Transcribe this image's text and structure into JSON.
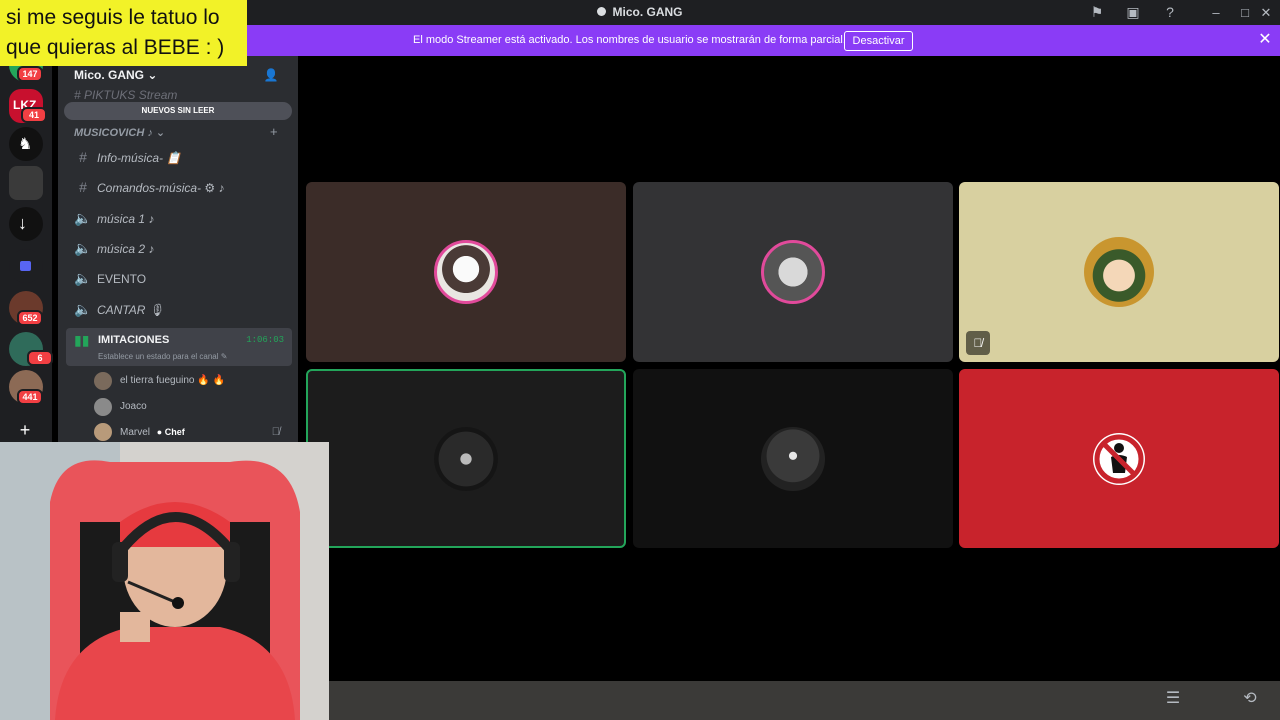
{
  "window": {
    "title": "Mico. GANG",
    "icons": [
      "flag-icon",
      "inbox-icon",
      "help-icon"
    ],
    "controls": [
      "minimize",
      "maximize",
      "close"
    ]
  },
  "banner": {
    "message": "El modo Streamer está activado. Los nombres de usuario se mostrarán de forma parcial.",
    "button": "Desactivar",
    "close": "✕"
  },
  "caption": {
    "line1": "si me seguis le tatuo lo",
    "line2": "que quieras al BEBE : )"
  },
  "servers": [
    {
      "badge": "147"
    },
    {
      "label": "LKZ",
      "badge": "41"
    },
    {
      "badge": ""
    },
    {
      "badge": ""
    },
    {
      "badge": ""
    },
    {
      "badge": ""
    },
    {
      "badge": "652"
    },
    {
      "badge": "6"
    },
    {
      "badge": "441"
    }
  ],
  "sidebar": {
    "server_name": "Mico. GANG",
    "faded_channel": "PIKTUKS Stream",
    "unread_pill": "NUEVOS SIN LEER",
    "category": "MUSICOVICH",
    "channels": [
      {
        "name": "Info-música-",
        "type": "text"
      },
      {
        "name": "Comandos-música-",
        "type": "text"
      },
      {
        "name": "música 1",
        "type": "voice"
      },
      {
        "name": "música 2",
        "type": "voice"
      },
      {
        "name": "EVENTO",
        "type": "voice"
      },
      {
        "name": "CANTAR",
        "type": "voice"
      }
    ],
    "active_channel": {
      "name": "IMITACIONES",
      "timer": "1:06:03",
      "status": "Establece un estado para el canal"
    },
    "voice_users": [
      {
        "name": "el tierra fueguino",
        "tag": "",
        "muted": false
      },
      {
        "name": "Joaco",
        "tag": "",
        "muted": false
      },
      {
        "name": "Marvel",
        "tag": "Chef",
        "muted": true
      }
    ]
  },
  "tiles": [
    {
      "bg": "#3b2c28",
      "avatar": "cat-avatar",
      "speaking": false,
      "muted": false
    },
    {
      "bg": "#333335",
      "avatar": "man-avatar",
      "speaking": false,
      "muted": false
    },
    {
      "bg": "#d8d0a0",
      "avatar": "mii-avatar",
      "speaking": false,
      "muted": true
    },
    {
      "bg": "#1c1c1c",
      "avatar": "dark-avatar",
      "speaking": true,
      "muted": false
    },
    {
      "bg": "#111111",
      "avatar": "skull-avatar",
      "speaking": false,
      "muted": false
    },
    {
      "bg": "#c8232c",
      "avatar": "prohibited-avatar",
      "speaking": false,
      "muted": false
    }
  ],
  "colors": {
    "accent": "#8a3cf6",
    "speaking": "#23a55a",
    "badge": "#f23f43"
  }
}
